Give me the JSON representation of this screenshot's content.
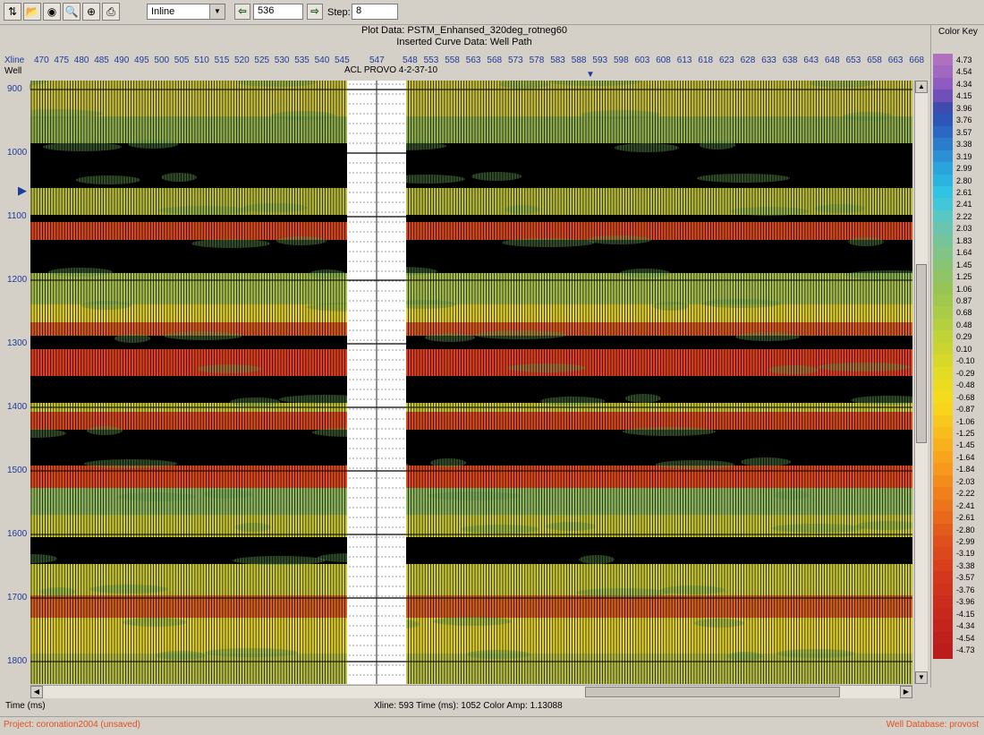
{
  "toolbar": {
    "buttons": [
      "import-icon",
      "open-folder-icon",
      "view-eye-icon",
      "zoom-icon",
      "zoom-area-icon",
      "print-icon"
    ],
    "view_select": "Inline",
    "current_value": "536",
    "step_label": "Step:",
    "step_value": "8"
  },
  "header": {
    "plot_data": "Plot Data: PSTM_Enhansed_320deg_rotneg60",
    "curve_data": "Inserted Curve Data:  Well Path"
  },
  "axis": {
    "xline_label": "Xline",
    "well_label": "Well",
    "xlines": [
      "470",
      "475",
      "480",
      "485",
      "490",
      "495",
      "500",
      "505",
      "510",
      "515",
      "520",
      "525",
      "530",
      "535",
      "540",
      "545",
      "547",
      "548",
      "553",
      "558",
      "563",
      "568",
      "573",
      "578",
      "583",
      "588",
      "593",
      "598",
      "603",
      "608",
      "613",
      "618",
      "623",
      "628",
      "633",
      "638",
      "643",
      "648",
      "653",
      "658",
      "663",
      "668"
    ],
    "well_name": "ACL PROVO 4-2-37-10",
    "times": [
      "900",
      "1000",
      "1100",
      "1200",
      "1300",
      "1400",
      "1500",
      "1600",
      "1700",
      "1800"
    ],
    "time_label": "Time (ms)"
  },
  "status": {
    "readout": "Xline: 593  Time (ms): 1052  Color Amp: 1.13088"
  },
  "footer": {
    "project": "Project: coronation2004 (unsaved)",
    "well_db": "Well Database: provost"
  },
  "colorkey": {
    "title": "Color Key",
    "values": [
      "4.73",
      "4.54",
      "4.34",
      "4.15",
      "3.96",
      "3.76",
      "3.57",
      "3.38",
      "3.19",
      "2.99",
      "2.80",
      "2.61",
      "2.41",
      "2.22",
      "2.03",
      "1.83",
      "1.64",
      "1.45",
      "1.25",
      "1.06",
      "0.87",
      "0.68",
      "0.48",
      "0.29",
      "0.10",
      "-0.10",
      "-0.29",
      "-0.48",
      "-0.68",
      "-0.87",
      "-1.06",
      "-1.25",
      "-1.45",
      "-1.64",
      "-1.84",
      "-2.03",
      "-2.22",
      "-2.41",
      "-2.61",
      "-2.80",
      "-2.99",
      "-3.19",
      "-3.38",
      "-3.57",
      "-3.76",
      "-3.96",
      "-4.15",
      "-4.34",
      "-4.54",
      "-4.73"
    ],
    "colors": [
      "#b070c0",
      "#a068c0",
      "#8e5cc0",
      "#7050b8",
      "#3e4cb0",
      "#2e56b8",
      "#2a68c4",
      "#2c7ccc",
      "#2c90d4",
      "#2aa4dc",
      "#2cb4e0",
      "#30c4e4",
      "#40c8d8",
      "#58c8c4",
      "#6ac4b0",
      "#76c49c",
      "#80c488",
      "#88c476",
      "#90c464",
      "#98c456",
      "#a0c84e",
      "#a8cc48",
      "#b4d040",
      "#c0d438",
      "#ccd430",
      "#d8d828",
      "#e2dc24",
      "#ecdc20",
      "#f4dc1c",
      "#f8d41c",
      "#f8c81c",
      "#f8bc1c",
      "#f8b01c",
      "#f8a41c",
      "#f8981c",
      "#f48c1c",
      "#f0801c",
      "#ec741c",
      "#e8681c",
      "#e45c1c",
      "#e0501c",
      "#dc481c",
      "#d8401c",
      "#d4381c",
      "#d0321c",
      "#cc2c1c",
      "#c8281c",
      "#c4241c",
      "#c0201c",
      "#bc1c1c"
    ]
  }
}
